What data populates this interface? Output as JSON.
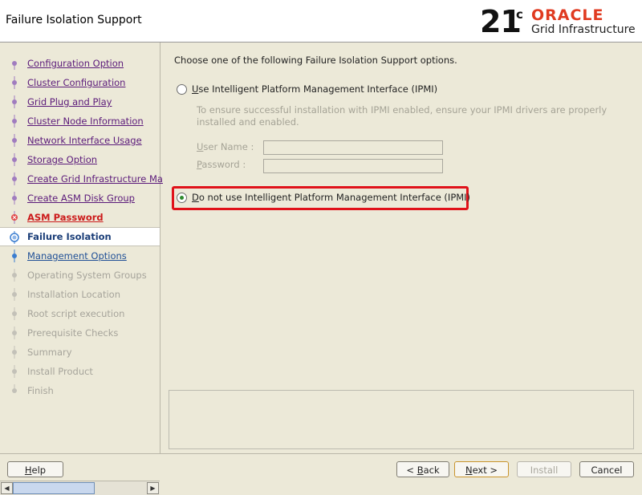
{
  "header": {
    "title": "Failure Isolation Support",
    "logo": {
      "version": "21",
      "version_sup": "c",
      "brand": "ORACLE",
      "product": "Grid Infrastructure"
    }
  },
  "sidebar": {
    "steps": [
      {
        "label": "Configuration Option",
        "state": "link"
      },
      {
        "label": "Cluster Configuration",
        "state": "link"
      },
      {
        "label": "Grid Plug and Play",
        "state": "link"
      },
      {
        "label": "Cluster Node Information",
        "state": "link"
      },
      {
        "label": "Network Interface Usage",
        "state": "link"
      },
      {
        "label": "Storage Option",
        "state": "link"
      },
      {
        "label": "Create Grid Infrastructure Ma",
        "state": "link"
      },
      {
        "label": "Create ASM Disk Group",
        "state": "link"
      },
      {
        "label": "ASM Password",
        "state": "error"
      },
      {
        "label": "Failure Isolation",
        "state": "current"
      },
      {
        "label": "Management Options",
        "state": "next"
      },
      {
        "label": "Operating System Groups",
        "state": "disabled"
      },
      {
        "label": "Installation Location",
        "state": "disabled"
      },
      {
        "label": "Root script execution",
        "state": "disabled"
      },
      {
        "label": "Prerequisite Checks",
        "state": "disabled"
      },
      {
        "label": "Summary",
        "state": "disabled"
      },
      {
        "label": "Install Product",
        "state": "disabled"
      },
      {
        "label": "Finish",
        "state": "disabled"
      }
    ]
  },
  "main": {
    "prompt": "Choose one of the following Failure Isolation Support options.",
    "option_ipmi": {
      "mnemonic": "U",
      "rest": "se Intelligent Platform Management Interface (IPMI)",
      "selected": false
    },
    "ipmi_hint": "To ensure successful installation with IPMI enabled, ensure your IPMI drivers are properly installed and enabled.",
    "user_name": {
      "mnemonic": "U",
      "rest": "ser Name :",
      "value": ""
    },
    "password": {
      "mnemonic": "P",
      "rest": "assword :",
      "value": ""
    },
    "option_no_ipmi": {
      "mnemonic": "D",
      "rest": "o not use Intelligent Platform Management Interface (IPMI)",
      "selected": true
    }
  },
  "footer": {
    "help": {
      "mnemonic": "H",
      "rest": "elp"
    },
    "back": {
      "prefix": "< ",
      "mnemonic": "B",
      "rest": "ack"
    },
    "next": {
      "mnemonic": "N",
      "rest": "ext >"
    },
    "install": {
      "label": "Install"
    },
    "cancel": {
      "label": "Cancel"
    }
  },
  "colors": {
    "accent_highlight": "#e0121a",
    "link": "#5b1a7a",
    "error": "#cc1b1b",
    "current": "#1b3e78",
    "brand": "#e03a20"
  }
}
